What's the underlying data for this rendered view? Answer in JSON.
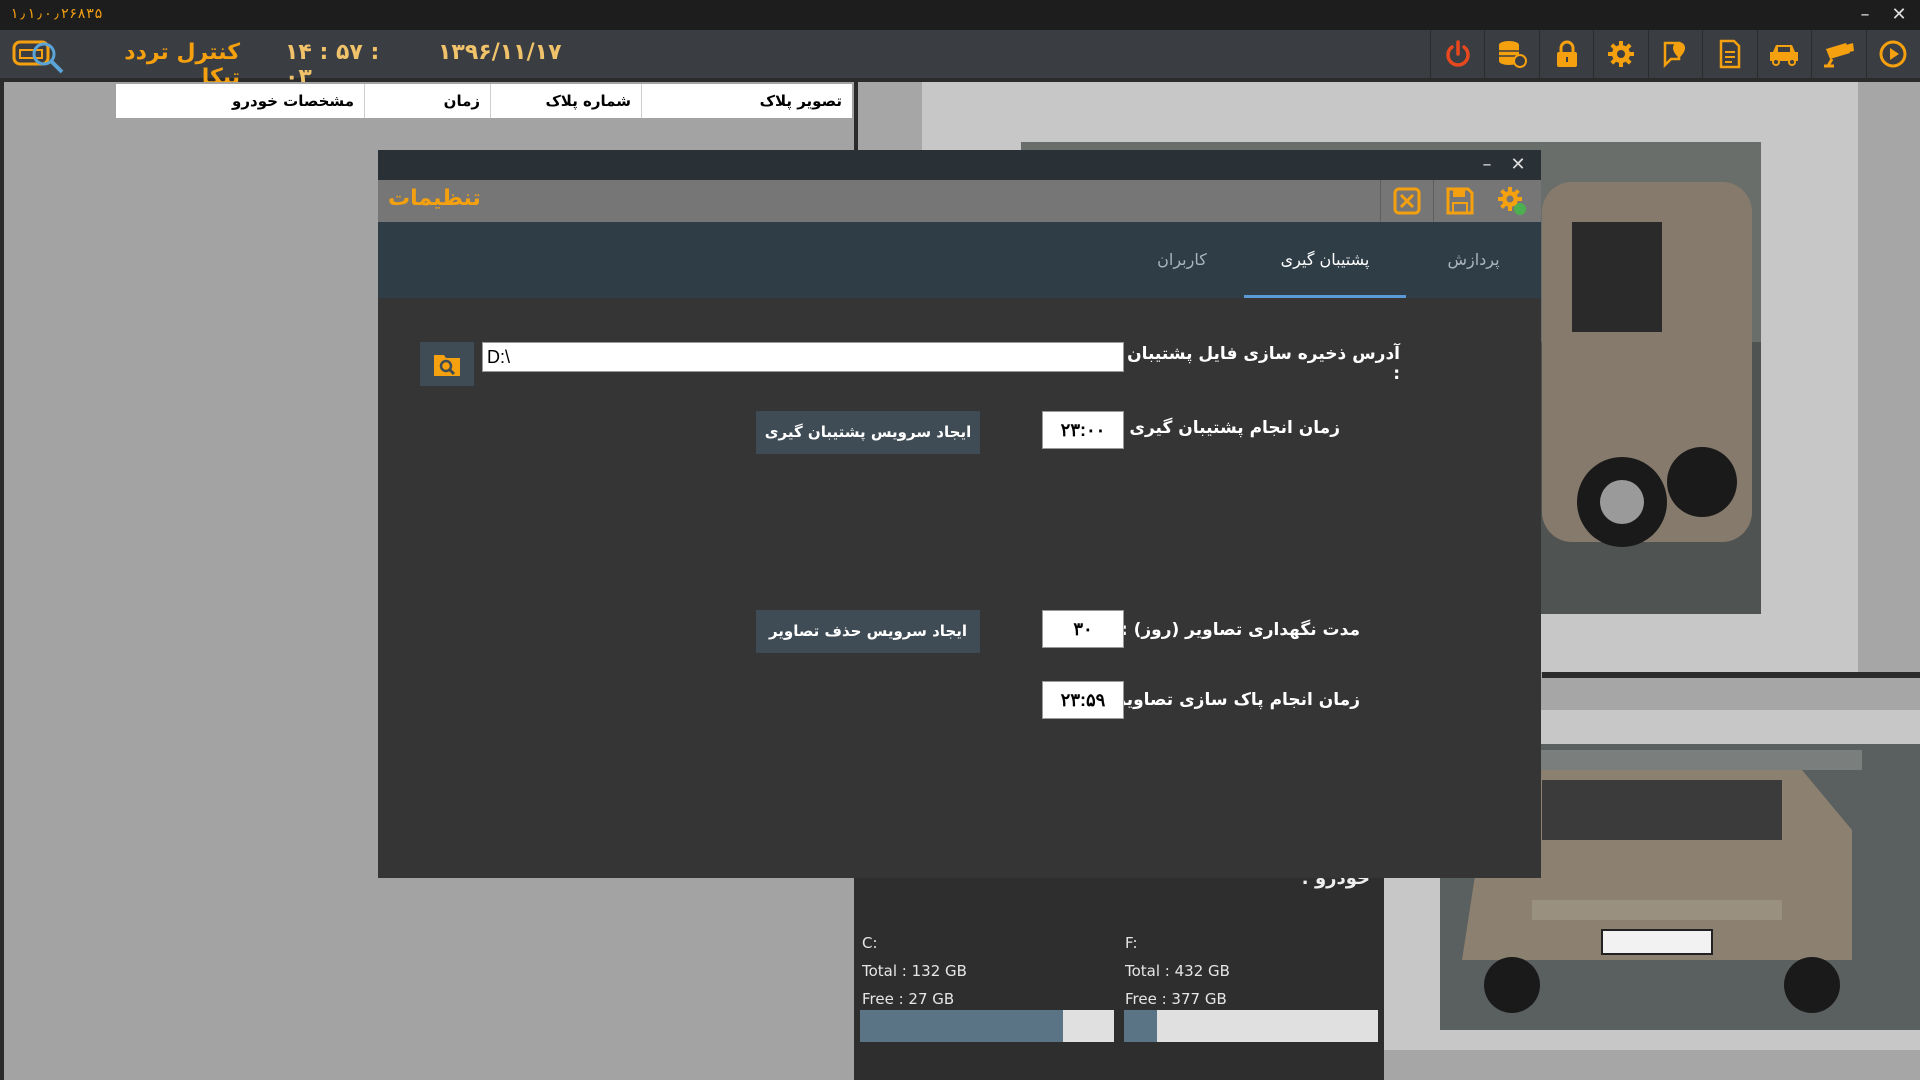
{
  "app": {
    "version": "۱٫۱٫۰٫۲۶۸۳۵",
    "title": "کنترل تردد تیکا",
    "clock": "۱۴ : ۵۷ : ۰۳",
    "date": "۱۳۹۶/۱۱/۱۷",
    "window_min": "–",
    "window_close": "✕"
  },
  "toolbar": {
    "icons": [
      "play-icon",
      "camera-icon",
      "car-icon",
      "report-icon",
      "map-pin-icon",
      "settings-icon",
      "lock-icon",
      "database-icon",
      "power-icon"
    ],
    "accent": "#f5a00f"
  },
  "list": {
    "columns": [
      "تصویر پلاک",
      "شماره پلاک",
      "زمان",
      "مشخصات خودرو"
    ]
  },
  "info": {
    "vehicle_label": "خودرو :",
    "drives": [
      {
        "name": "C:",
        "total": "Total : 132 GB",
        "free": "Free : 27 GB",
        "used_fraction": 0.8
      },
      {
        "name": "F:",
        "total": "Total : 432 GB",
        "free": "Free : 377 GB",
        "used_fraction": 0.13
      }
    ]
  },
  "dialog": {
    "title": "تنظیمات",
    "min": "–",
    "close": "✕",
    "tabs": [
      {
        "label": "پردازش",
        "active": false
      },
      {
        "label": "پشتیبان گیری",
        "active": true
      },
      {
        "label": "کاربران",
        "active": false
      }
    ],
    "backup": {
      "path_label": "آدرس ذخیره سازی فایل پشتیبان :",
      "path_value": "D:\\",
      "time_label": "زمان انجام پشتیبان گیری :",
      "time_value": "۲۳:۰۰",
      "create_backup_service": "ایجاد سرویس پشتیبان گیری",
      "retention_label": "مدت نگهداری تصاویر (روز) :",
      "retention_value": "۳۰",
      "create_delete_service": "ایجاد سرویس حذف تصاویر",
      "cleanup_label": "زمان انجام پاک سازی تصاویر :",
      "cleanup_value": "۲۳:۵۹"
    }
  }
}
